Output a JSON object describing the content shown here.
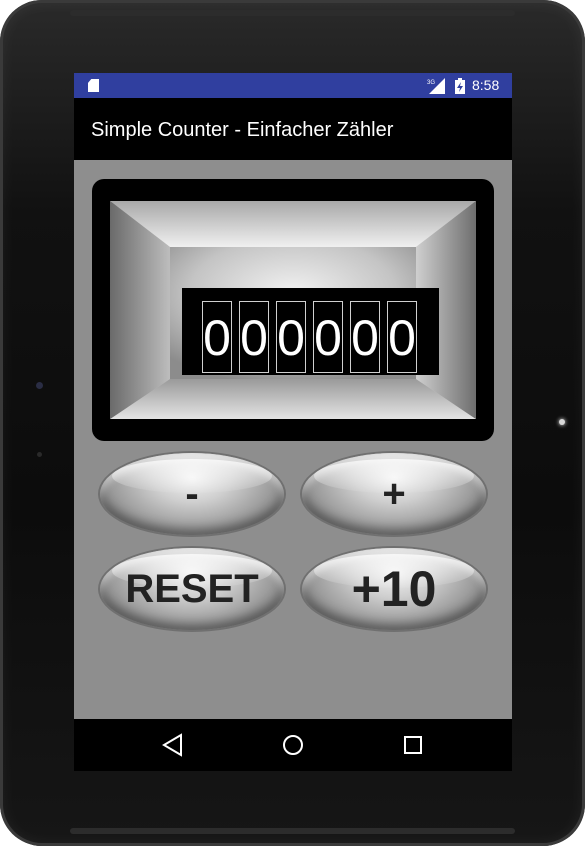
{
  "status_bar": {
    "network_type": "3G",
    "time": "8:58",
    "color": "#303f9f"
  },
  "app_bar": {
    "title": "Simple Counter - Einfacher Zähler"
  },
  "counter": {
    "value": "000000",
    "digits": [
      "0",
      "0",
      "0",
      "0",
      "0",
      "0"
    ]
  },
  "buttons": {
    "decrement_label": "-",
    "increment_label": "+",
    "reset_label": "RESET",
    "add_ten_label": "+10"
  },
  "nav_bar": {
    "icons": [
      "back-icon",
      "home-icon",
      "recent-apps-icon"
    ]
  },
  "colors": {
    "content_background": "#8e8e8e",
    "status_bar": "#303f9f",
    "app_bar": "#000000"
  }
}
